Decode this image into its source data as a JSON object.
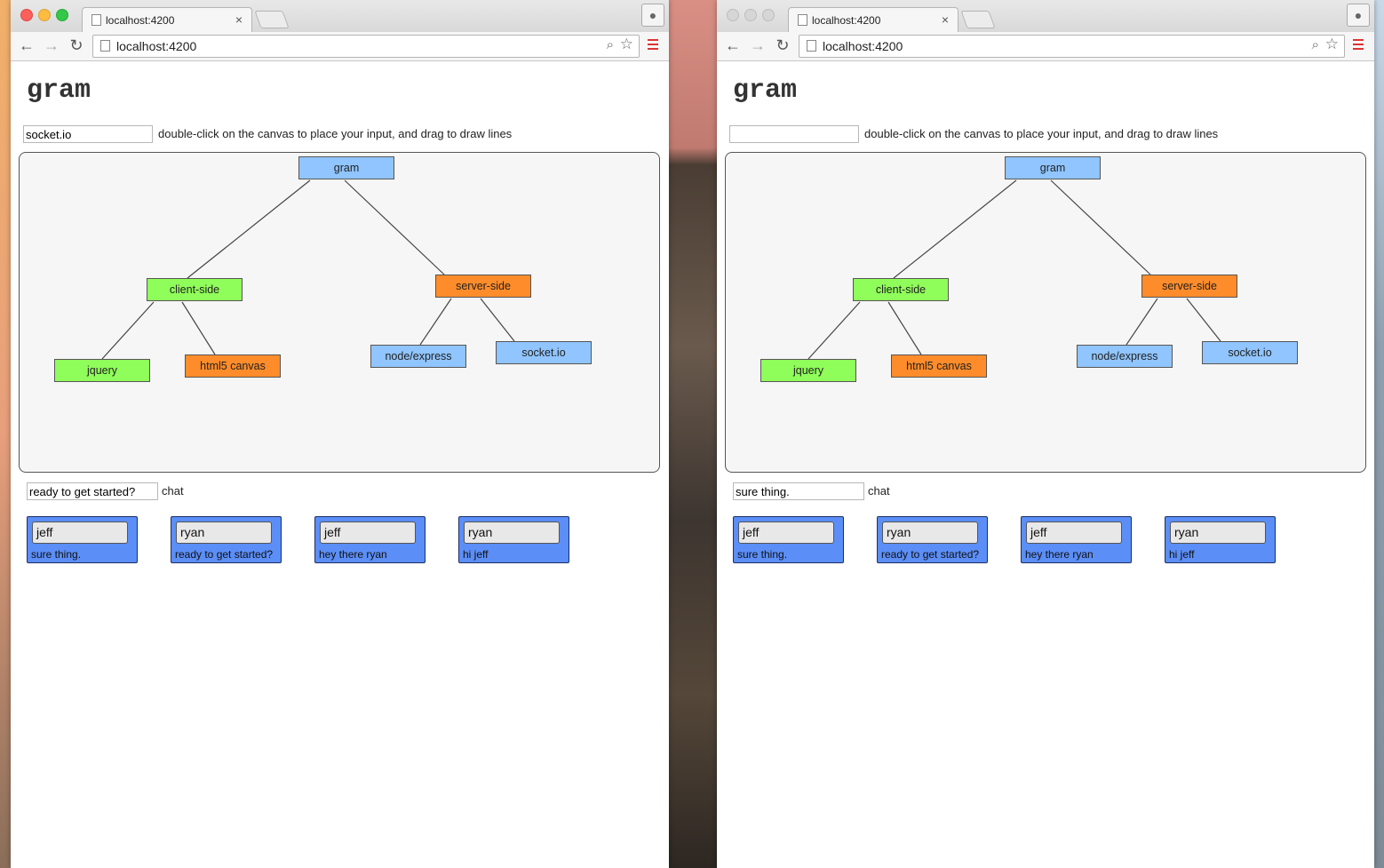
{
  "colors": {
    "node_blue": "#90c5ff",
    "node_green": "#8ffe5a",
    "node_orange": "#ff8c2a",
    "message_bubble": "#5b8ef7",
    "canvas_bg": "#f6f6f6"
  },
  "windows": [
    {
      "tab": {
        "title": "localhost:4200",
        "close": "×"
      },
      "address": "localhost:4200",
      "app_title": "gram",
      "node_input_value": "socket.io",
      "instruction": "double-click on the canvas to place your input, and drag to draw lines",
      "chat_input_value": "ready to get started?",
      "chat_label": "chat"
    },
    {
      "tab": {
        "title": "localhost:4200",
        "close": "×"
      },
      "address": "localhost:4200",
      "app_title": "gram",
      "node_input_value": "",
      "instruction": "double-click on the canvas to place your input, and drag to draw lines",
      "chat_input_value": "sure thing.",
      "chat_label": "chat"
    }
  ],
  "graph": {
    "nodes": [
      {
        "id": "gram",
        "label": "gram",
        "color": "blue"
      },
      {
        "id": "client",
        "label": "client-side",
        "color": "green"
      },
      {
        "id": "server",
        "label": "server-side",
        "color": "orange"
      },
      {
        "id": "jquery",
        "label": "jquery",
        "color": "green"
      },
      {
        "id": "canvas",
        "label": "html5 canvas",
        "color": "orange"
      },
      {
        "id": "node",
        "label": "node/express",
        "color": "blue"
      },
      {
        "id": "socket",
        "label": "socket.io",
        "color": "blue"
      }
    ],
    "edges": [
      [
        "gram",
        "client"
      ],
      [
        "gram",
        "server"
      ],
      [
        "client",
        "jquery"
      ],
      [
        "client",
        "canvas"
      ],
      [
        "server",
        "node"
      ],
      [
        "server",
        "socket"
      ]
    ]
  },
  "messages": [
    {
      "author": "jeff",
      "text": "sure thing."
    },
    {
      "author": "ryan",
      "text": "ready to get started?"
    },
    {
      "author": "jeff",
      "text": "hey there ryan"
    },
    {
      "author": "ryan",
      "text": "hi jeff"
    }
  ],
  "icons": {
    "back": "←",
    "forward": "→",
    "reload": "↻",
    "zoom": "⌕",
    "star": "☆",
    "profile": "👤"
  }
}
